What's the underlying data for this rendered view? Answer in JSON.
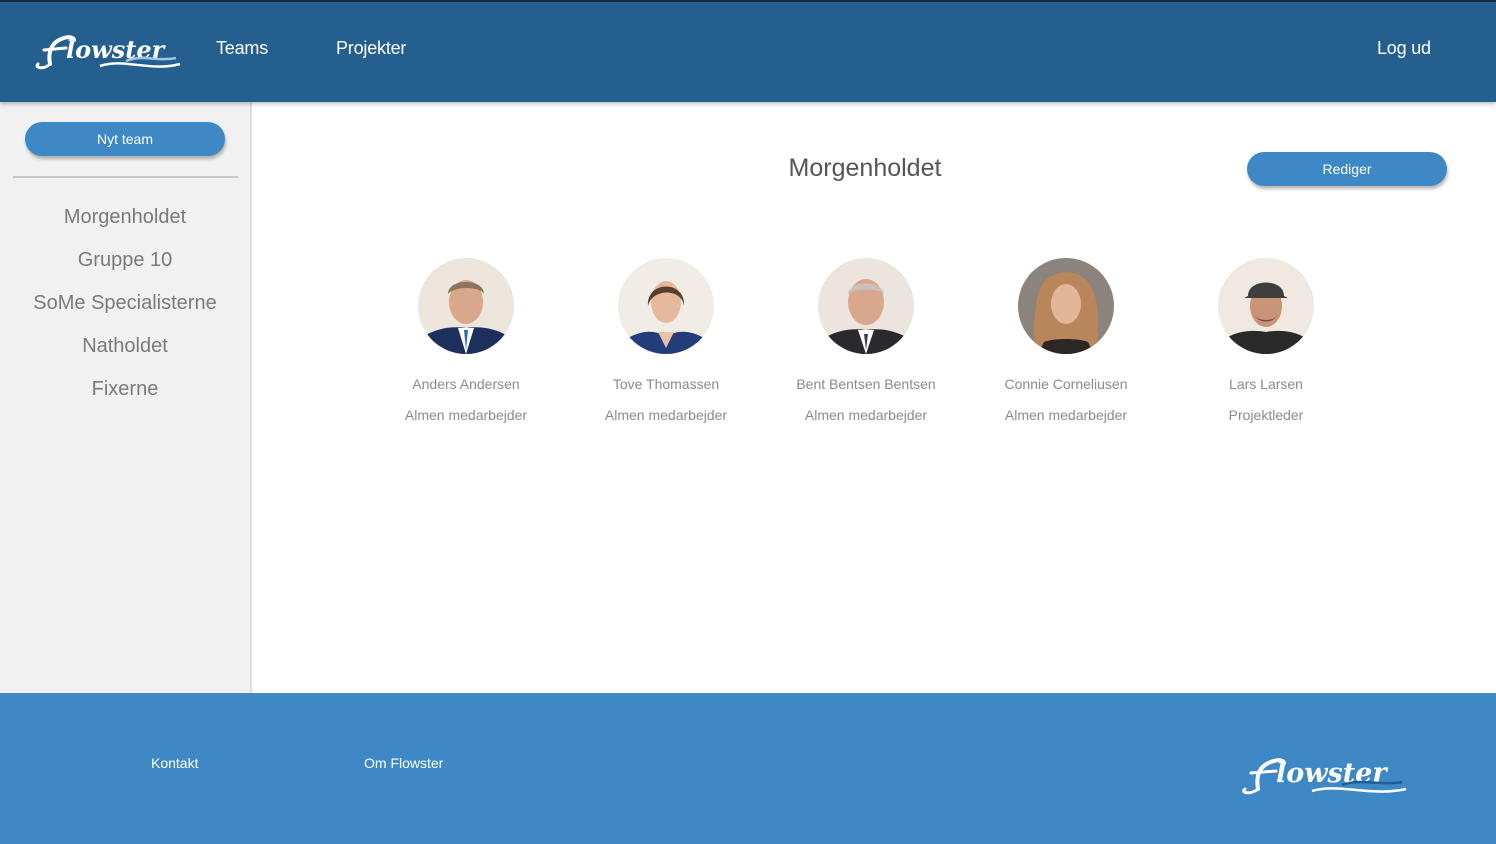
{
  "header": {
    "logo_text": "Flowster",
    "nav": {
      "teams": "Teams",
      "projekter": "Projekter"
    },
    "logout": "Log ud"
  },
  "sidebar": {
    "new_team_label": "Nyt team",
    "teams": [
      "Morgenholdet",
      "Gruppe 10",
      "SoMe Specialisterne",
      "Natholdet",
      "Fixerne"
    ]
  },
  "main": {
    "team_title": "Morgenholdet",
    "edit_label": "Rediger",
    "members": [
      {
        "name": "Anders Andersen",
        "role": "Almen medarbejder"
      },
      {
        "name": "Tove Thomassen",
        "role": "Almen medarbejder"
      },
      {
        "name": "Bent Bentsen Bentsen",
        "role": "Almen medarbejder"
      },
      {
        "name": "Connie Corneliusen",
        "role": "Almen medarbejder"
      },
      {
        "name": "Lars Larsen",
        "role": "Projektleder"
      }
    ]
  },
  "footer": {
    "links": {
      "kontakt": "Kontakt",
      "om": "Om Flowster"
    },
    "logo_text": "Flowster"
  },
  "colors": {
    "header": "#245f8f",
    "accent": "#3d88c5",
    "sidebar_bg": "#f1f1f1",
    "text_muted": "#8a8a8a"
  }
}
